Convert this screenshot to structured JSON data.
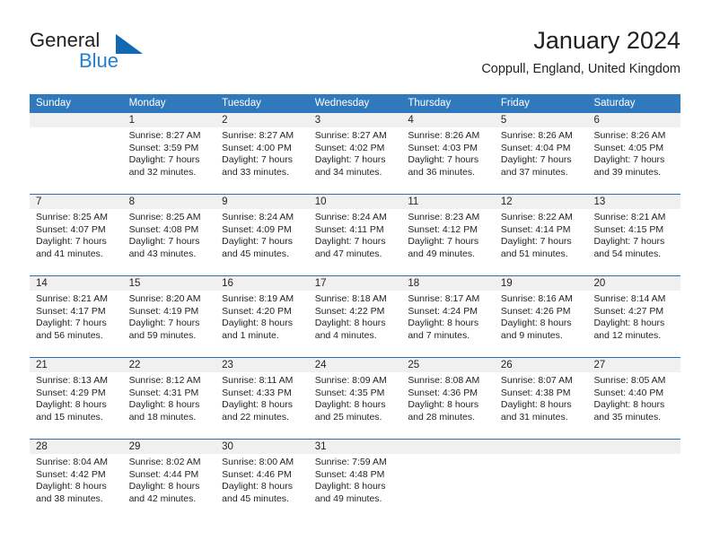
{
  "brand": {
    "name_part1": "General",
    "name_part2": "Blue",
    "triangle_color": "#1268b3",
    "blue_text_color": "#1f7fd0"
  },
  "header": {
    "title": "January 2024",
    "subtitle": "Coppull, England, United Kingdom"
  },
  "theme": {
    "header_row_bg": "#3079bd",
    "header_row_text": "#ffffff",
    "date_band_bg": "#f0f0f0",
    "week_separator": "#2f6fad",
    "body_text": "#231f20"
  },
  "calendar": {
    "weekday_headers": [
      "Sunday",
      "Monday",
      "Tuesday",
      "Wednesday",
      "Thursday",
      "Friday",
      "Saturday"
    ],
    "weeks": [
      [
        {
          "day": "",
          "lines": []
        },
        {
          "day": "1",
          "lines": [
            "Sunrise: 8:27 AM",
            "Sunset: 3:59 PM",
            "Daylight: 7 hours",
            "and 32 minutes."
          ]
        },
        {
          "day": "2",
          "lines": [
            "Sunrise: 8:27 AM",
            "Sunset: 4:00 PM",
            "Daylight: 7 hours",
            "and 33 minutes."
          ]
        },
        {
          "day": "3",
          "lines": [
            "Sunrise: 8:27 AM",
            "Sunset: 4:02 PM",
            "Daylight: 7 hours",
            "and 34 minutes."
          ]
        },
        {
          "day": "4",
          "lines": [
            "Sunrise: 8:26 AM",
            "Sunset: 4:03 PM",
            "Daylight: 7 hours",
            "and 36 minutes."
          ]
        },
        {
          "day": "5",
          "lines": [
            "Sunrise: 8:26 AM",
            "Sunset: 4:04 PM",
            "Daylight: 7 hours",
            "and 37 minutes."
          ]
        },
        {
          "day": "6",
          "lines": [
            "Sunrise: 8:26 AM",
            "Sunset: 4:05 PM",
            "Daylight: 7 hours",
            "and 39 minutes."
          ]
        }
      ],
      [
        {
          "day": "7",
          "lines": [
            "Sunrise: 8:25 AM",
            "Sunset: 4:07 PM",
            "Daylight: 7 hours",
            "and 41 minutes."
          ]
        },
        {
          "day": "8",
          "lines": [
            "Sunrise: 8:25 AM",
            "Sunset: 4:08 PM",
            "Daylight: 7 hours",
            "and 43 minutes."
          ]
        },
        {
          "day": "9",
          "lines": [
            "Sunrise: 8:24 AM",
            "Sunset: 4:09 PM",
            "Daylight: 7 hours",
            "and 45 minutes."
          ]
        },
        {
          "day": "10",
          "lines": [
            "Sunrise: 8:24 AM",
            "Sunset: 4:11 PM",
            "Daylight: 7 hours",
            "and 47 minutes."
          ]
        },
        {
          "day": "11",
          "lines": [
            "Sunrise: 8:23 AM",
            "Sunset: 4:12 PM",
            "Daylight: 7 hours",
            "and 49 minutes."
          ]
        },
        {
          "day": "12",
          "lines": [
            "Sunrise: 8:22 AM",
            "Sunset: 4:14 PM",
            "Daylight: 7 hours",
            "and 51 minutes."
          ]
        },
        {
          "day": "13",
          "lines": [
            "Sunrise: 8:21 AM",
            "Sunset: 4:15 PM",
            "Daylight: 7 hours",
            "and 54 minutes."
          ]
        }
      ],
      [
        {
          "day": "14",
          "lines": [
            "Sunrise: 8:21 AM",
            "Sunset: 4:17 PM",
            "Daylight: 7 hours",
            "and 56 minutes."
          ]
        },
        {
          "day": "15",
          "lines": [
            "Sunrise: 8:20 AM",
            "Sunset: 4:19 PM",
            "Daylight: 7 hours",
            "and 59 minutes."
          ]
        },
        {
          "day": "16",
          "lines": [
            "Sunrise: 8:19 AM",
            "Sunset: 4:20 PM",
            "Daylight: 8 hours",
            "and 1 minute."
          ]
        },
        {
          "day": "17",
          "lines": [
            "Sunrise: 8:18 AM",
            "Sunset: 4:22 PM",
            "Daylight: 8 hours",
            "and 4 minutes."
          ]
        },
        {
          "day": "18",
          "lines": [
            "Sunrise: 8:17 AM",
            "Sunset: 4:24 PM",
            "Daylight: 8 hours",
            "and 7 minutes."
          ]
        },
        {
          "day": "19",
          "lines": [
            "Sunrise: 8:16 AM",
            "Sunset: 4:26 PM",
            "Daylight: 8 hours",
            "and 9 minutes."
          ]
        },
        {
          "day": "20",
          "lines": [
            "Sunrise: 8:14 AM",
            "Sunset: 4:27 PM",
            "Daylight: 8 hours",
            "and 12 minutes."
          ]
        }
      ],
      [
        {
          "day": "21",
          "lines": [
            "Sunrise: 8:13 AM",
            "Sunset: 4:29 PM",
            "Daylight: 8 hours",
            "and 15 minutes."
          ]
        },
        {
          "day": "22",
          "lines": [
            "Sunrise: 8:12 AM",
            "Sunset: 4:31 PM",
            "Daylight: 8 hours",
            "and 18 minutes."
          ]
        },
        {
          "day": "23",
          "lines": [
            "Sunrise: 8:11 AM",
            "Sunset: 4:33 PM",
            "Daylight: 8 hours",
            "and 22 minutes."
          ]
        },
        {
          "day": "24",
          "lines": [
            "Sunrise: 8:09 AM",
            "Sunset: 4:35 PM",
            "Daylight: 8 hours",
            "and 25 minutes."
          ]
        },
        {
          "day": "25",
          "lines": [
            "Sunrise: 8:08 AM",
            "Sunset: 4:36 PM",
            "Daylight: 8 hours",
            "and 28 minutes."
          ]
        },
        {
          "day": "26",
          "lines": [
            "Sunrise: 8:07 AM",
            "Sunset: 4:38 PM",
            "Daylight: 8 hours",
            "and 31 minutes."
          ]
        },
        {
          "day": "27",
          "lines": [
            "Sunrise: 8:05 AM",
            "Sunset: 4:40 PM",
            "Daylight: 8 hours",
            "and 35 minutes."
          ]
        }
      ],
      [
        {
          "day": "28",
          "lines": [
            "Sunrise: 8:04 AM",
            "Sunset: 4:42 PM",
            "Daylight: 8 hours",
            "and 38 minutes."
          ]
        },
        {
          "day": "29",
          "lines": [
            "Sunrise: 8:02 AM",
            "Sunset: 4:44 PM",
            "Daylight: 8 hours",
            "and 42 minutes."
          ]
        },
        {
          "day": "30",
          "lines": [
            "Sunrise: 8:00 AM",
            "Sunset: 4:46 PM",
            "Daylight: 8 hours",
            "and 45 minutes."
          ]
        },
        {
          "day": "31",
          "lines": [
            "Sunrise: 7:59 AM",
            "Sunset: 4:48 PM",
            "Daylight: 8 hours",
            "and 49 minutes."
          ]
        },
        {
          "day": "",
          "lines": []
        },
        {
          "day": "",
          "lines": []
        },
        {
          "day": "",
          "lines": []
        }
      ]
    ]
  }
}
